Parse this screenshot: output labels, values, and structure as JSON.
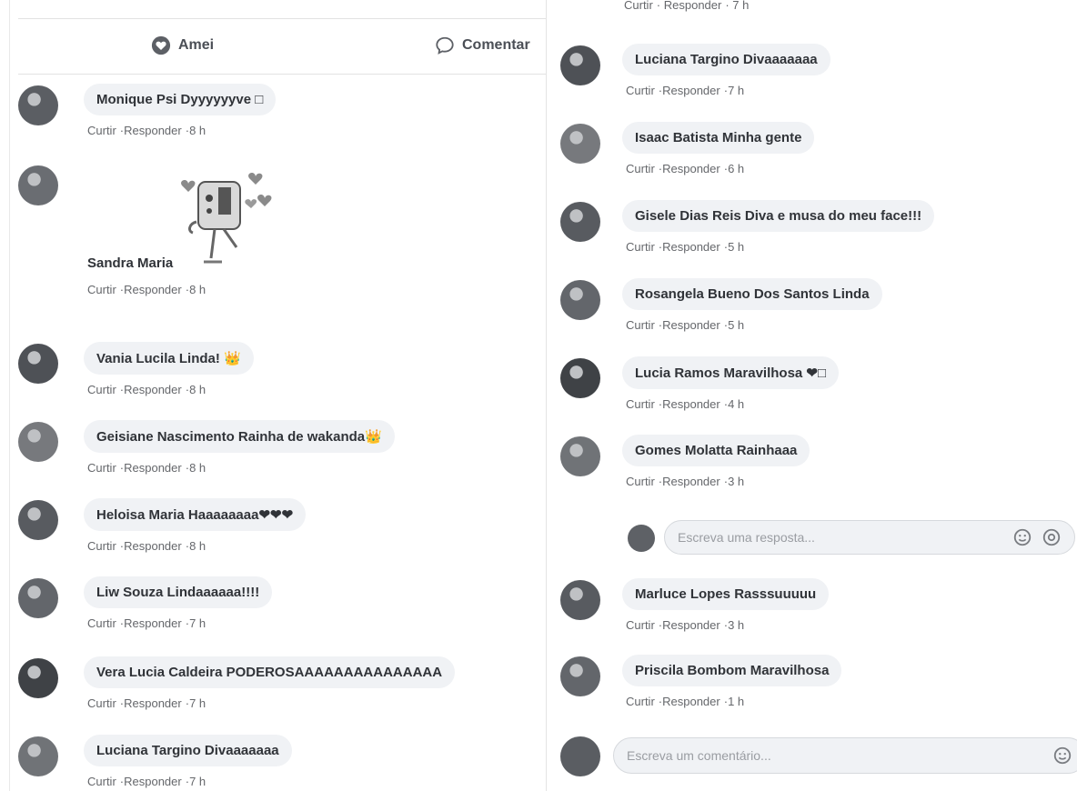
{
  "left": {
    "actions": {
      "love": "Amei",
      "comment": "Comentar"
    },
    "comments": [
      {
        "name": "Monique Psi",
        "text": "Dyyyyyyve □",
        "meta": [
          "Curtir",
          "Responder",
          "8 h"
        ]
      },
      {
        "name": "Sandra Maria",
        "text": "",
        "meta": [
          "Curtir",
          "Responder",
          "8 h"
        ],
        "sticker": true
      },
      {
        "name": "Vania Lucila",
        "text": "Linda! 👑",
        "meta": [
          "Curtir",
          "Responder",
          "8 h"
        ]
      },
      {
        "name": "Geisiane Nascimento",
        "text": "Rainha de wakanda👑",
        "meta": [
          "Curtir",
          "Responder",
          "8 h"
        ]
      },
      {
        "name": "Heloisa Maria",
        "text": "Haaaaaaaa❤❤❤",
        "meta": [
          "Curtir",
          "Responder",
          "8 h"
        ]
      },
      {
        "name": "Liw Souza",
        "text": "Lindaaaaaa!!!!",
        "meta": [
          "Curtir",
          "Responder",
          "7 h"
        ]
      },
      {
        "name": "Vera Lucia Caldeira",
        "text": "PODEROSAAAAAAAAAAAAAAA",
        "meta": [
          "Curtir",
          "Responder",
          "7 h"
        ]
      },
      {
        "name": "Luciana Targino",
        "text": "Divaaaaaaa",
        "meta": [
          "Curtir",
          "Responder",
          "7 h"
        ]
      }
    ]
  },
  "right": {
    "top_meta": [
      "Curtir",
      "Responder",
      "7 h"
    ],
    "comments": [
      {
        "name": "Luciana Targino",
        "text": "Divaaaaaaa",
        "meta": [
          "Curtir",
          "Responder",
          "7 h"
        ]
      },
      {
        "name": "Isaac Batista",
        "text": "Minha gente",
        "meta": [
          "Curtir",
          "Responder",
          "6 h"
        ]
      },
      {
        "name": "Gisele Dias Reis",
        "text": "Diva e musa do meu face!!!",
        "meta": [
          "Curtir",
          "Responder",
          "5 h"
        ]
      },
      {
        "name": "Rosangela Bueno Dos Santos",
        "text": "Linda",
        "meta": [
          "Curtir",
          "Responder",
          "5 h"
        ]
      },
      {
        "name": "Lucia Ramos",
        "text": "Maravilhosa ❤□",
        "meta": [
          "Curtir",
          "Responder",
          "4 h"
        ]
      },
      {
        "name": "Gomes Molatta",
        "text": "Rainhaaa",
        "meta": [
          "Curtir",
          "Responder",
          "3 h"
        ]
      }
    ],
    "reply_placeholder": "Escreva uma resposta...",
    "comments_after": [
      {
        "name": "Marluce Lopes",
        "text": "Rasssuuuuu",
        "meta": [
          "Curtir",
          "Responder",
          "3 h"
        ]
      },
      {
        "name": "Priscila Bombom",
        "text": "Maravilhosa",
        "meta": [
          "Curtir",
          "Responder",
          "1 h"
        ]
      }
    ],
    "comment_placeholder": "Escreva um comentário..."
  }
}
